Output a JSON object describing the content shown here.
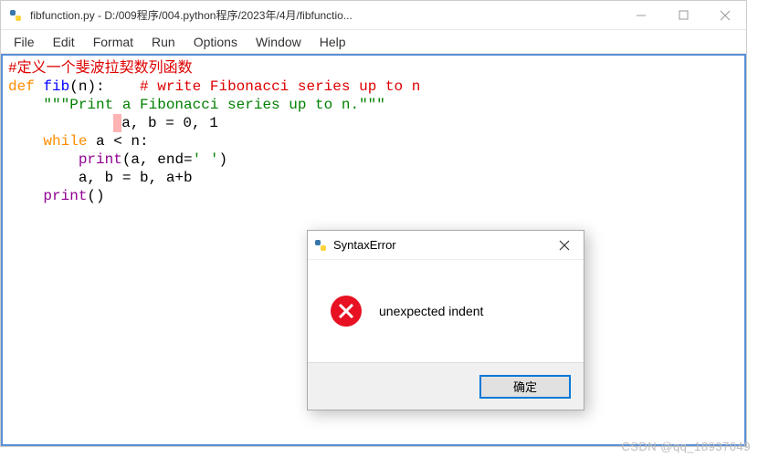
{
  "window": {
    "title": "fibfunction.py - D:/009程序/004.python程序/2023年/4月/fibfunctio..."
  },
  "menu": {
    "items": [
      "File",
      "Edit",
      "Format",
      "Run",
      "Options",
      "Window",
      "Help"
    ]
  },
  "code": {
    "line1_comment": "#定义一个斐波拉契数列函数",
    "line2_def": "def ",
    "line2_name": "fib",
    "line2_paren_open": "(",
    "line2_param": "n",
    "line2_paren_close": "):    ",
    "line2_comment": "# write Fibonacci series up to n",
    "line3_indent": "    ",
    "line3_docstring": "\"\"\"Print a Fibonacci series up to n.\"\"\"",
    "line4_indent": "            ",
    "line4_rest": "a, b = 0, 1",
    "line5_indent": "    ",
    "line5_while": "while ",
    "line5_cond": "a < n:",
    "line6_indent": "        ",
    "line6_print": "print",
    "line6_args_open": "(a, end=",
    "line6_str": "' '",
    "line6_args_close": ")",
    "line7_indent": "        ",
    "line7_assign": "a, b = b, a+b",
    "line8_indent": "    ",
    "line8_print": "print",
    "line8_paren": "()"
  },
  "dialog": {
    "title": "SyntaxError",
    "message": "unexpected indent",
    "ok_label": "确定"
  },
  "watermark": "CSDN @qq_18937049"
}
